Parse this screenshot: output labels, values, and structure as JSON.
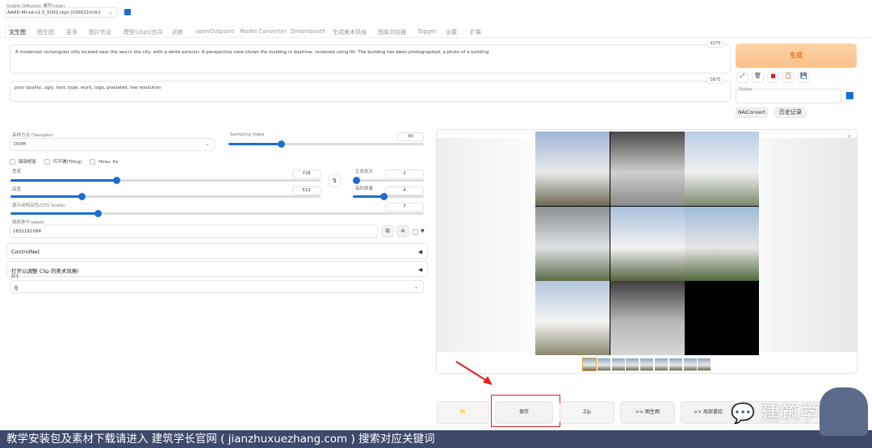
{
  "model": {
    "label": "Stable Diffusion 模型(ckpt)",
    "value": "AARD-MI-sd-v1.5_5000.ckpt [036021fc0c]"
  },
  "tabs": [
    "文生图",
    "图生图",
    "更多",
    "图片信息",
    "模型(ckpt)合并",
    "训练",
    "openOutpaint",
    "Model Converter",
    "Dreambooth",
    "生成美术风格",
    "图库浏览器",
    "Tagger",
    "设置",
    "扩展"
  ],
  "prompt": {
    "text": "A modernist rectangular villa located near the sea in the city, with a white exterior. A perspective view shows the building in daytime, rendered using lilt. The building has been photographed,   a photo of a building",
    "count": "41/75"
  },
  "negative": {
    "text": "poor quality, ugly, text, type, word, logo, pixelated, low resolution",
    "count": "18/75"
  },
  "generate_label": "生成",
  "styles_label": "Styles",
  "nai_label": "NAIConvert",
  "history_label": "历史记录",
  "sampler": {
    "label": "采样方法 (Sampler)",
    "value": "DDIM"
  },
  "steps": {
    "label": "Sampling steps",
    "value": "40",
    "fraction": 0.27
  },
  "checks": [
    "面部修复",
    "可平铺(Tiling)",
    "Hires. fix"
  ],
  "width": {
    "label": "宽度",
    "value": "728",
    "fraction": 0.34
  },
  "height": {
    "label": "高度",
    "value": "512",
    "fraction": 0.23
  },
  "batch_count": {
    "label": "生成批次",
    "value": "2",
    "fraction": 0.04
  },
  "batch_size": {
    "label": "每批数量",
    "value": "4",
    "fraction": 0.43
  },
  "cfg": {
    "label": "提示词相关性(CFG Scale)",
    "value": "7",
    "fraction": 0.21
  },
  "seed": {
    "label": "随机种子(seed)",
    "value": "1832161084"
  },
  "controlnet_label": "ControlNet",
  "clip_label": "打开以调整 Clip 的美术风格!",
  "script": {
    "label": "脚本",
    "value": "无"
  },
  "actions": {
    "folder": "📁",
    "save": "保存",
    "zip": "Zip",
    "img2img": ">> 图生图",
    "inpaint": ">> 局部重绘"
  },
  "watermark": "建筑学长",
  "banner": "教学安装包及素材下载请进入  建筑学长官网 ( jianzhuxuezhang.com ) 搜索对应关键词",
  "colors": {
    "accent": "#1a6fd1",
    "generate": "#fbc58e",
    "banner": "#3d4a6b",
    "highlight": "#e02020"
  }
}
